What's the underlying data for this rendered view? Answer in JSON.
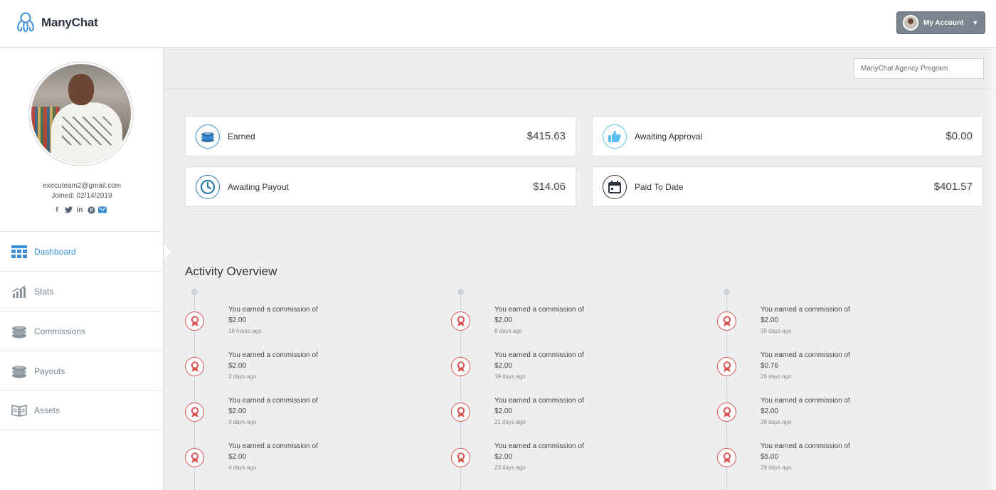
{
  "header": {
    "brand": "ManyChat",
    "account_label": "My Account"
  },
  "sidebar": {
    "email": "executeam2@gmail.com",
    "joined": "Joined: 02/14/2019",
    "social": [
      "facebook-icon",
      "twitter-icon",
      "linkedin-icon",
      "pinterest-icon",
      "mail-icon"
    ],
    "nav": [
      {
        "label": "Dashboard",
        "icon": "dashboard-icon",
        "active": true
      },
      {
        "label": "Stats",
        "icon": "stats-icon"
      },
      {
        "label": "Commissions",
        "icon": "coins-icon"
      },
      {
        "label": "Payouts",
        "icon": "coins-icon"
      },
      {
        "label": "Assets",
        "icon": "book-icon"
      }
    ]
  },
  "program_select": "ManyChat Agency Program",
  "cards": {
    "earned": {
      "label": "Earned",
      "value": "$415.63"
    },
    "awaiting_approval": {
      "label": "Awaiting Approval",
      "value": "$0.00"
    },
    "awaiting_payout": {
      "label": "Awaiting Payout",
      "value": "$14.06"
    },
    "paid_to_date": {
      "label": "Paid To Date",
      "value": "$401.57"
    }
  },
  "activity": {
    "title": "Activity Overview",
    "columns": [
      [
        {
          "text": "You earned a commission of",
          "amount": "$2.00",
          "time": "16 hours ago"
        },
        {
          "text": "You earned a commission of",
          "amount": "$2.00",
          "time": "3 days ago"
        },
        {
          "text": "You earned a commission of",
          "amount": "$2.00",
          "time": "3 days ago"
        },
        {
          "text": "You earned a commission of",
          "amount": "$2.00",
          "time": "4 days ago"
        }
      ],
      [
        {
          "text": "You earned a commission of",
          "amount": "$2.00",
          "time": "8 days ago"
        },
        {
          "text": "You earned a commission of",
          "amount": "$2.00",
          "time": "19 days ago"
        },
        {
          "text": "You earned a commission of",
          "amount": "$2.00",
          "time": "21 days ago"
        },
        {
          "text": "You earned a commission of",
          "amount": "$2.00",
          "time": "23 days ago"
        }
      ],
      [
        {
          "text": "You earned a commission of",
          "amount": "$2.00",
          "time": "25 days ago"
        },
        {
          "text": "You earned a commission of",
          "amount": "$0.76",
          "time": "26 days ago"
        },
        {
          "text": "You earned a commission of",
          "amount": "$2.00",
          "time": "28 days ago"
        },
        {
          "text": "You earned a commission of",
          "amount": "$5.00",
          "time": "29 days ago"
        }
      ]
    ]
  },
  "colors": {
    "accent": "#3b8ed6",
    "badge_red": "#d9534f",
    "account_button": "#7b858f"
  }
}
